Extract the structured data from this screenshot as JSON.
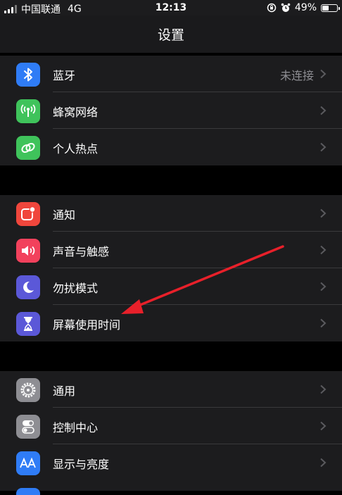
{
  "status": {
    "carrier": "中国联通",
    "network": "4G",
    "time": "12:13",
    "battery": "49%",
    "battery_level": 0.49
  },
  "header": {
    "title": "设置"
  },
  "groups": [
    {
      "items": [
        {
          "label": "蓝牙",
          "value": "未连接",
          "icon": "bluetooth-icon",
          "color": "#2f7cf6"
        },
        {
          "label": "蜂窝网络",
          "icon": "cellular-antenna-icon",
          "color": "#3fc35b"
        },
        {
          "label": "个人热点",
          "icon": "hotspot-link-icon",
          "color": "#3fc35b"
        }
      ]
    },
    {
      "items": [
        {
          "label": "通知",
          "icon": "notification-badge-icon",
          "color": "#f0463c"
        },
        {
          "label": "声音与触感",
          "icon": "speaker-icon",
          "color": "#f2415c"
        },
        {
          "label": "勿扰模式",
          "icon": "moon-icon",
          "color": "#5b58d8"
        },
        {
          "label": "屏幕使用时间",
          "icon": "hourglass-icon",
          "color": "#5b58d8"
        }
      ]
    },
    {
      "items": [
        {
          "label": "通用",
          "icon": "gear-icon",
          "color": "#8e8e93"
        },
        {
          "label": "控制中心",
          "icon": "toggles-icon",
          "color": "#8e8e93"
        },
        {
          "label": "显示与亮度",
          "icon": "text-size-icon",
          "color": "#2f7cf6"
        }
      ]
    }
  ],
  "colors": {
    "annotation_arrow": "#e8202a",
    "chevron": "#5a5a5e"
  }
}
